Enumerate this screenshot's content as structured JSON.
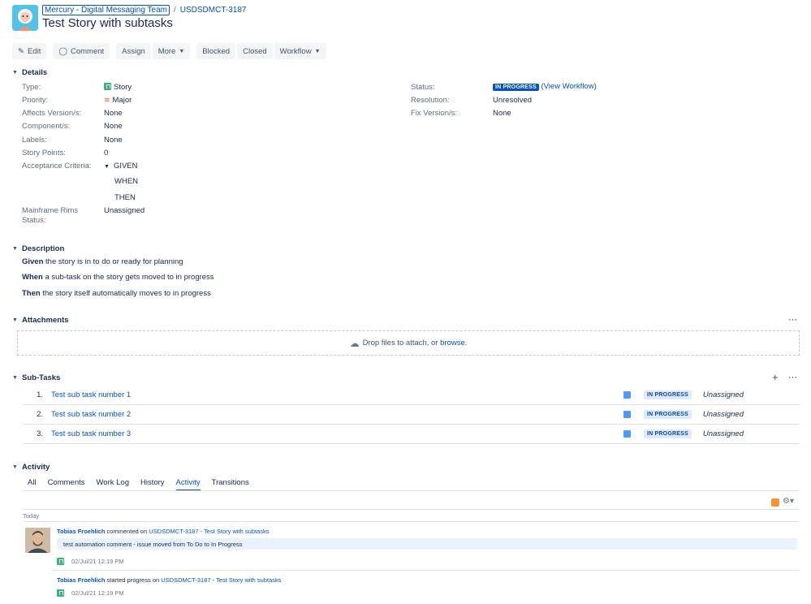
{
  "header": {
    "project": "Mercury - Digital Messaging Team",
    "separator": "/",
    "issue_key": "USDSDMCT-3187",
    "title": "Test Story with subtasks"
  },
  "toolbar": {
    "edit": "Edit",
    "comment": "Comment",
    "assign": "Assign",
    "more": "More",
    "blocked": "Blocked",
    "closed": "Closed",
    "workflow": "Workflow"
  },
  "details": {
    "heading": "Details",
    "type_label": "Type:",
    "type_value": "Story",
    "priority_label": "Priority:",
    "priority_value": "Major",
    "affects_label": "Affects Version/s:",
    "affects_value": "None",
    "component_label": "Component/s:",
    "component_value": "None",
    "labels_label": "Labels:",
    "labels_value": "None",
    "points_label": "Story Points:",
    "points_value": "0",
    "acceptance_label": "Acceptance Criteria:",
    "acceptance_given": "GIVEN",
    "acceptance_when": "WHEN",
    "acceptance_then": "THEN",
    "rims_label_1": "Mainframe Rims",
    "rims_label_2": "Status:",
    "rims_value": "Unassigned",
    "status_label": "Status:",
    "status_value": "IN PROGRESS",
    "view_workflow": "(View Workflow)",
    "resolution_label": "Resolution:",
    "resolution_value": "Unresolved",
    "fix_label": "Fix Version/s:",
    "fix_value": "None"
  },
  "description": {
    "heading": "Description",
    "given_bold": "Given",
    "given_text": " the story is in to do or ready for planning",
    "when_bold": "When",
    "when_text": " a sub-task on the story gets moved to in progress",
    "then_bold": "Then",
    "then_text": " the story itself automatically moves to in progress"
  },
  "attachments": {
    "heading": "Attachments",
    "drop_text": "Drop files to attach, or ",
    "browse": "browse",
    "period": "."
  },
  "subtasks": {
    "heading": "Sub-Tasks",
    "items": [
      {
        "num": "1.",
        "summary": "Test sub task number 1",
        "status": "IN PROGRESS",
        "assignee": "Unassigned"
      },
      {
        "num": "2.",
        "summary": "Test sub task number 2",
        "status": "IN PROGRESS",
        "assignee": "Unassigned"
      },
      {
        "num": "3.",
        "summary": "Test sub task number 3",
        "status": "IN PROGRESS",
        "assignee": "Unassigned"
      }
    ]
  },
  "activity": {
    "heading": "Activity",
    "tabs": [
      "All",
      "Comments",
      "Work Log",
      "History",
      "Activity",
      "Transitions"
    ],
    "active_tab": "Activity",
    "today": "Today",
    "entries": [
      {
        "user": "Tobias Froehlich",
        "action": " commented on ",
        "target": "USDSDMCT-3187 - Test Story with subtasks",
        "comment": "test automation comment - issue moved from To Do to In Progress",
        "time": "02/Jul/21 12:19 PM"
      },
      {
        "user": "Tobias Froehlich",
        "action": " started progress on ",
        "target": "USDSDMCT-3187 - Test Story with subtasks",
        "time": "02/Jul/21 12:19 PM"
      }
    ]
  },
  "colors": {
    "link": "#0052cc",
    "status_blue": "#0052cc",
    "story_green": "#36b37e",
    "rss_orange": "#f79232"
  }
}
